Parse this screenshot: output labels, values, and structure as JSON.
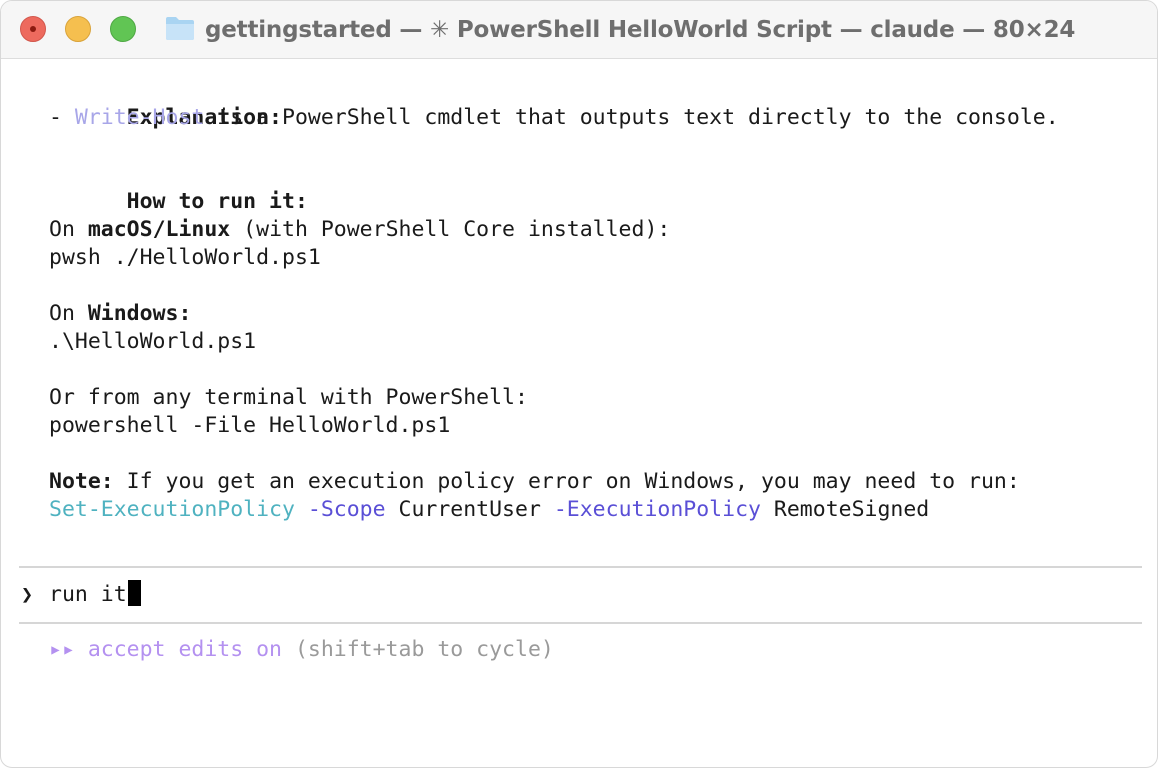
{
  "window": {
    "title": "gettingstarted — ✳ PowerShell HelloWorld Script — claude — 80×24",
    "folder_icon": "folder-icon"
  },
  "terminal": {
    "explanation_heading": "Explanation:",
    "explanation_dash": "- ",
    "explanation_code": "Write-Host",
    "explanation_rest": " is a PowerShell cmdlet that outputs text directly to the console.",
    "howto_heading": "How to run it:",
    "mac_prefix": "On ",
    "mac_bold": "macOS/Linux",
    "mac_rest": " (with PowerShell Core installed):",
    "mac_command": "pwsh ./HelloWorld.ps1",
    "win_prefix": "On ",
    "win_bold": "Windows:",
    "win_command": ".\\HelloWorld.ps1",
    "any_terminal": "Or from any terminal with PowerShell:",
    "any_command": "powershell -File HelloWorld.ps1",
    "note_bold": "Note:",
    "note_rest": " If you get an execution policy error on Windows, you may need to run:",
    "policy_cmdlet": "Set-ExecutionPolicy",
    "policy_scope_flag": " -Scope",
    "policy_scope_value": " CurrentUser",
    "policy_exec_flag": " -ExecutionPolicy",
    "policy_exec_value": " RemoteSigned"
  },
  "prompt": {
    "chevron": "❯",
    "input_value": "run it"
  },
  "status": {
    "arrows": "▸▸",
    "mode_label": " accept edits on",
    "hint": " (shift+tab to cycle)"
  },
  "colors": {
    "close": "#ed6a5e",
    "minimize": "#f5bf4f",
    "zoom": "#61c554",
    "code_lavender": "#a8a6e8",
    "cmdlet_teal": "#4fb2c0",
    "flag_violet": "#5a4fd6",
    "mode_purple": "#b491f0"
  }
}
